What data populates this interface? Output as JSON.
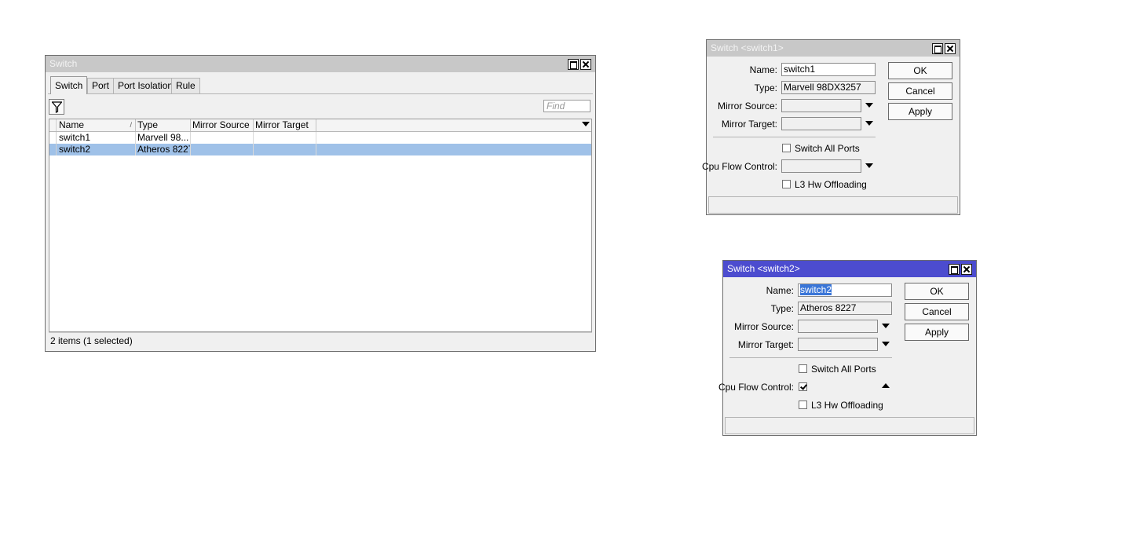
{
  "main_window": {
    "title": "Switch",
    "tabs": [
      {
        "label": "Switch",
        "active": true
      },
      {
        "label": "Port",
        "active": false
      },
      {
        "label": "Port Isolation",
        "active": false
      },
      {
        "label": "Rule",
        "active": false
      }
    ],
    "find_placeholder": "Find",
    "columns": [
      "Name",
      "Type",
      "Mirror Source",
      "Mirror Target"
    ],
    "rows": [
      {
        "name": "switch1",
        "type": "Marvell 98...",
        "mirror_source": "",
        "mirror_target": "",
        "selected": false
      },
      {
        "name": "switch2",
        "type": "Atheros 8227",
        "mirror_source": "",
        "mirror_target": "",
        "selected": true
      }
    ],
    "status": "2 items (1 selected)"
  },
  "dialog1": {
    "title": "Switch <switch1>",
    "labels": {
      "name": "Name:",
      "type": "Type:",
      "mirror_source": "Mirror Source:",
      "mirror_target": "Mirror Target:",
      "switch_all_ports": "Switch All Ports",
      "cpu_flow_control": "Cpu Flow Control:",
      "l3_hw_offloading": "L3 Hw Offloading"
    },
    "values": {
      "name": "switch1",
      "type": "Marvell 98DX3257",
      "mirror_source": "",
      "mirror_target": "",
      "cpu_flow_control": ""
    },
    "switch_all_ports_checked": false,
    "l3_hw_offloading_checked": false,
    "buttons": {
      "ok": "OK",
      "cancel": "Cancel",
      "apply": "Apply"
    }
  },
  "dialog2": {
    "title": "Switch <switch2>",
    "labels": {
      "name": "Name:",
      "type": "Type:",
      "mirror_source": "Mirror Source:",
      "mirror_target": "Mirror Target:",
      "switch_all_ports": "Switch All Ports",
      "cpu_flow_control": "Cpu Flow Control:",
      "l3_hw_offloading": "L3 Hw Offloading"
    },
    "values": {
      "name": "switch2",
      "type": "Atheros 8227",
      "mirror_source": "",
      "mirror_target": ""
    },
    "switch_all_ports_checked": false,
    "cpu_flow_control_checked": true,
    "l3_hw_offloading_checked": false,
    "buttons": {
      "ok": "OK",
      "cancel": "Cancel",
      "apply": "Apply"
    }
  },
  "colors": {
    "active_titlebar": "#4c4ccf",
    "inactive_titlebar": "#c8c8c8",
    "selected_row": "#9fc1e8",
    "window_bg": "#f0f0f0"
  }
}
